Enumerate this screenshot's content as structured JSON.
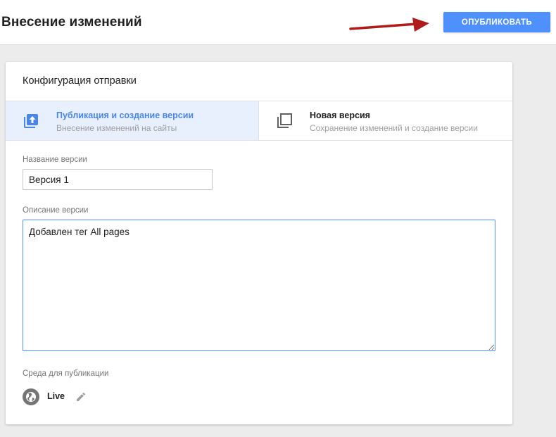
{
  "header": {
    "title": "Внесение изменений",
    "publish_label": "ОПУБЛИКОВАТЬ"
  },
  "card": {
    "title": "Конфигурация отправки",
    "options": [
      {
        "title": "Публикация и создание версии",
        "subtitle": "Внесение изменений на сайты",
        "selected": true,
        "icon": "publish-upload-icon"
      },
      {
        "title": "Новая версия",
        "subtitle": "Сохранение изменений и создание версии",
        "selected": false,
        "icon": "new-version-icon"
      }
    ],
    "version_name": {
      "label": "Название версии",
      "value": "Версия 1"
    },
    "version_description": {
      "label": "Описание версии",
      "value": "Добавлен тег All pages"
    },
    "environment": {
      "label": "Среда для публикации",
      "name": "Live",
      "icon": "globe-icon",
      "edit_icon": "pencil-icon"
    }
  },
  "colors": {
    "accent": "#4d90fe",
    "selected_bg": "#e8f0fe",
    "arrow": "#b01a1a"
  }
}
